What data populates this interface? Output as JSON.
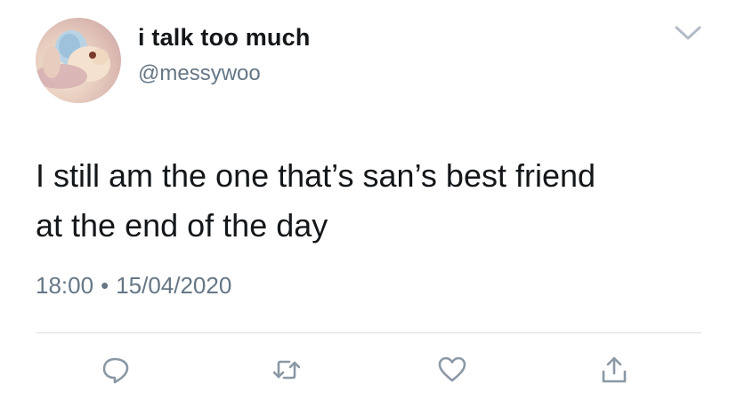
{
  "user": {
    "display_name": "i talk too much",
    "handle": "@messywoo"
  },
  "tweet": {
    "text": "I still am the one that’s san’s best friend\nat the end of the day",
    "time": "18:00",
    "separator": "•",
    "date": "15/04/2020"
  },
  "icons": {
    "menu": "chevron-down-icon",
    "reply": "reply-icon",
    "retweet": "retweet-icon",
    "like": "heart-icon",
    "share": "share-icon"
  },
  "colors": {
    "text_primary": "#14171a",
    "text_secondary": "#657786",
    "icon": "#8a98a5",
    "divider": "#d8dee3"
  }
}
